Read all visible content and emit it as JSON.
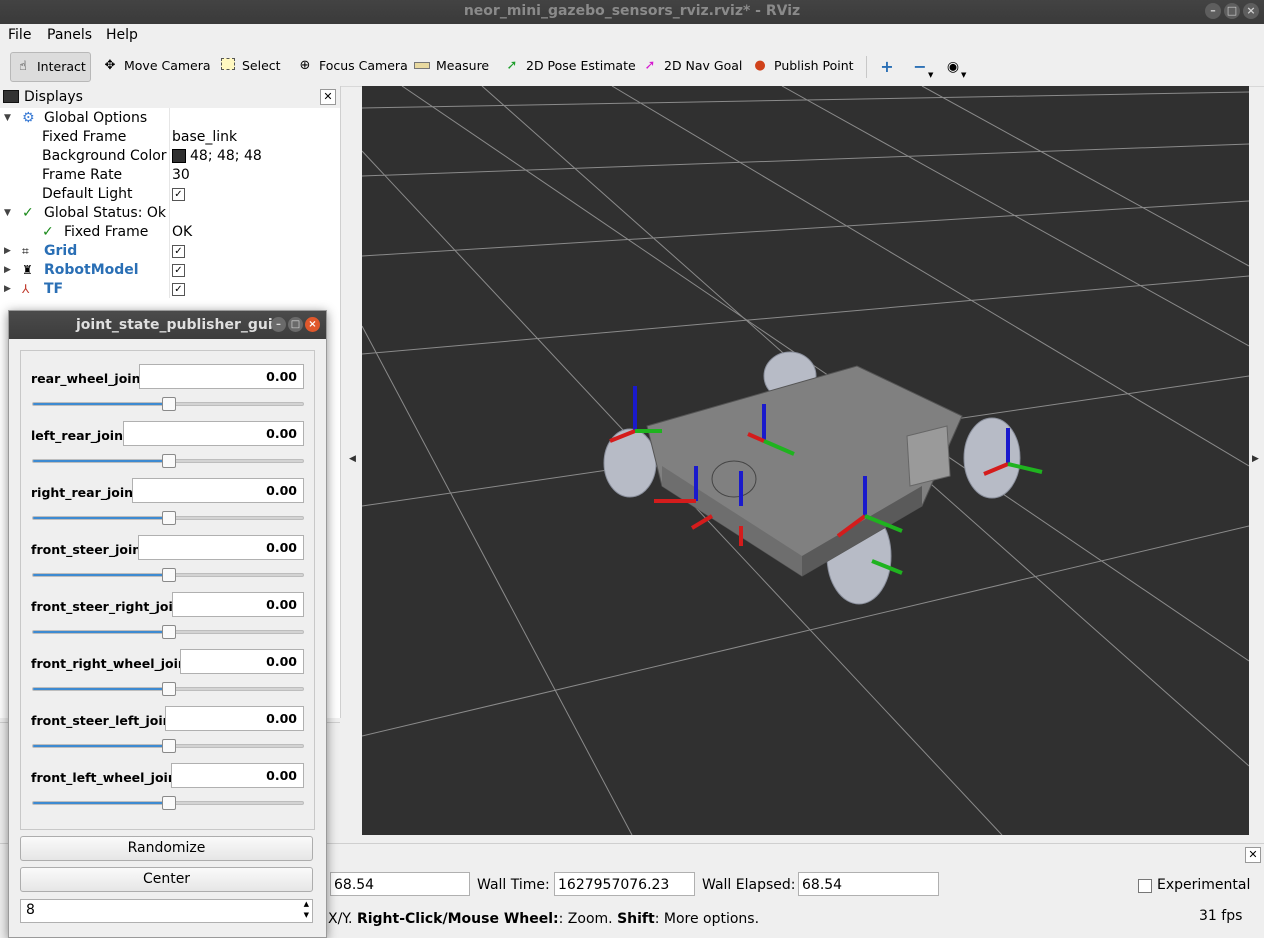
{
  "window": {
    "title": "neor_mini_gazebo_sensors_rviz.rviz* - RViz"
  },
  "menu": [
    "File",
    "Panels",
    "Help"
  ],
  "toolbar": {
    "tools": [
      "Interact",
      "Move Camera",
      "Select",
      "Focus Camera",
      "Measure",
      "2D Pose Estimate",
      "2D Nav Goal",
      "Publish Point"
    ],
    "active": "Interact"
  },
  "displays": {
    "title": "Displays",
    "global_options": {
      "label": "Global Options",
      "fixed_frame_label": "Fixed Frame",
      "fixed_frame_value": "base_link",
      "background_label": "Background Color",
      "background_value": "48; 48; 48",
      "background_color": "#303030",
      "frame_rate_label": "Frame Rate",
      "frame_rate_value": "30",
      "default_light_label": "Default Light",
      "default_light": true
    },
    "global_status": {
      "label": "Global Status: Ok",
      "fixed_frame_label": "Fixed Frame",
      "fixed_frame_value": "OK"
    },
    "items": [
      {
        "label": "Grid",
        "enabled": true,
        "icon": "grid-icon"
      },
      {
        "label": "RobotModel",
        "enabled": true,
        "icon": "robot-icon"
      },
      {
        "label": "TF",
        "enabled": true,
        "icon": "axes-icon"
      }
    ]
  },
  "jsp": {
    "title": "joint_state_publisher_gui",
    "joints": [
      {
        "name": "rear_wheel_joint",
        "value": "0.00",
        "slider": 0.5
      },
      {
        "name": "left_rear_joint",
        "value": "0.00",
        "slider": 0.5
      },
      {
        "name": "right_rear_joint",
        "value": "0.00",
        "slider": 0.5
      },
      {
        "name": "front_steer_joint",
        "value": "0.00",
        "slider": 0.5
      },
      {
        "name": "front_steer_right_joint",
        "value": "0.00",
        "slider": 0.5
      },
      {
        "name": "front_right_wheel_joint",
        "value": "0.00",
        "slider": 0.5
      },
      {
        "name": "front_steer_left_joint",
        "value": "0.00",
        "slider": 0.5
      },
      {
        "name": "front_left_wheel_joint",
        "value": "0.00",
        "slider": 0.5
      }
    ],
    "randomize_label": "Randomize",
    "center_label": "Center",
    "spin_value": "8"
  },
  "time": {
    "ros_elapsed_value": "68.54",
    "wall_time_label": "Wall Time:",
    "wall_time_value": "1627957076.23",
    "wall_elapsed_label": "Wall Elapsed:",
    "wall_elapsed_value": "68.54",
    "experimental_label": "Experimental",
    "hint_prefix": "X/Y.",
    "hint_b1": "Right-Click/Mouse Wheel:",
    "hint_t1": ": Zoom.",
    "hint_b2": "Shift",
    "hint_t2": ": More options.",
    "fps": "31 fps"
  },
  "colors": {
    "accent": "#3d8ad1",
    "link_blue": "#2a6fb5",
    "viewport_bg": "#303030"
  }
}
